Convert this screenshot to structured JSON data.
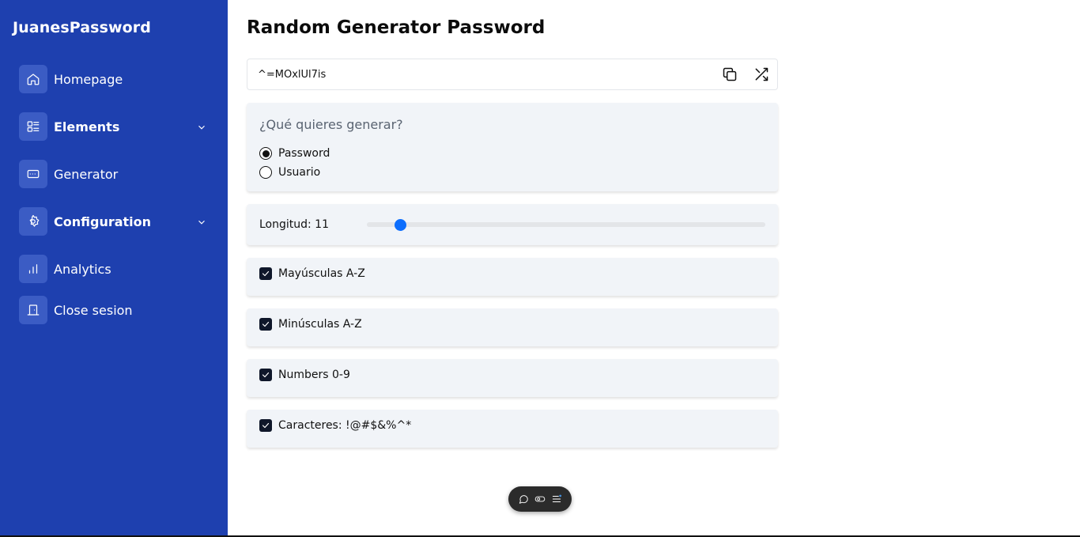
{
  "sidebar": {
    "brand": "JuanesPassword",
    "items": [
      {
        "label": "Homepage",
        "icon": "home-icon"
      },
      {
        "label": "Elements",
        "icon": "list-icon",
        "expandable": true
      },
      {
        "label": "Generator",
        "icon": "keyboard-icon"
      },
      {
        "label": "Configuration",
        "icon": "gear-icon",
        "expandable": true
      },
      {
        "label": "Analytics",
        "icon": "bar-chart-icon"
      },
      {
        "label": "Close sesion",
        "icon": "door-icon"
      }
    ]
  },
  "main": {
    "title": "Random Generator Password",
    "password": "^=MOxlUl7is",
    "mode": {
      "question": "¿Qué quieres generar?",
      "options": [
        {
          "label": "Password",
          "selected": true
        },
        {
          "label": "Usuario",
          "selected": false
        }
      ]
    },
    "length": {
      "label": "Longitud: 11",
      "value": 11,
      "fraction": 0.085
    },
    "options": [
      {
        "label": "Mayúsculas A-Z",
        "checked": true
      },
      {
        "label": "Minúsculas A-Z",
        "checked": true
      },
      {
        "label": "Numbers 0-9",
        "checked": true
      },
      {
        "label": "Caracteres: !@#$&%^*",
        "checked": true
      }
    ]
  },
  "colors": {
    "sidebar_bg": "#1e40af",
    "accent": "#0d6efd",
    "card_bg": "#f1f4f8"
  }
}
